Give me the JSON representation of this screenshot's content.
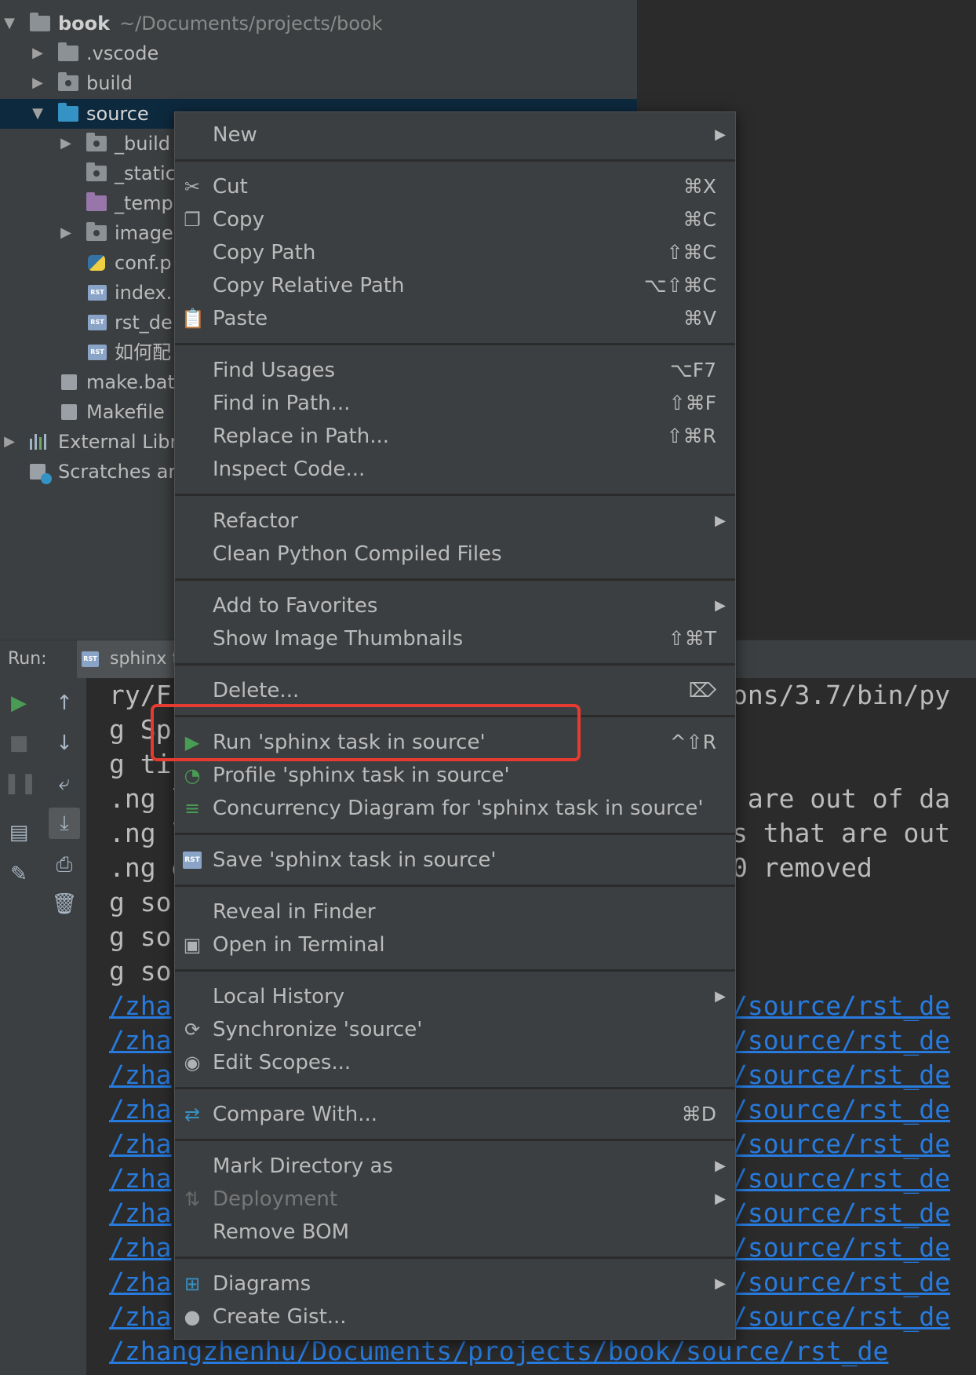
{
  "project_tree": {
    "root": {
      "name": "book",
      "path": "~/Documents/projects/book"
    },
    "items": [
      {
        "label": ".vscode"
      },
      {
        "label": "build"
      },
      {
        "label": "source"
      },
      {
        "label": "_build"
      },
      {
        "label": "_static"
      },
      {
        "label": "_temp"
      },
      {
        "label": "images"
      },
      {
        "label": "conf.p"
      },
      {
        "label": "index."
      },
      {
        "label": "rst_de"
      },
      {
        "label": "如何配"
      },
      {
        "label": "make.bat"
      },
      {
        "label": "Makefile"
      },
      {
        "label": "External Libr"
      },
      {
        "label": "Scratches ar"
      }
    ]
  },
  "run_panel": {
    "label": "Run:",
    "tab_label": "sphinx t",
    "console_lines": [
      "ry/F",
      "g Sp",
      "g ti",
      ".ng l",
      ".ng l",
      ".ng e",
      "g so",
      "g so",
      "g so",
      "/zha",
      "/zha",
      "/zha",
      "/zha",
      "/zha",
      "/zha",
      "/zha",
      "/zha",
      "/zha",
      "/zha",
      "/zhangzhenhu/Documents/projects/book/source/rst_de"
    ],
    "console_right": [
      "ons/3.7/bin/py",
      " are out of da",
      "s that are out",
      "0 removed",
      "/source/rst_de"
    ]
  },
  "context_menu": {
    "items": [
      {
        "label": "New",
        "shortcut": "",
        "icon": "none"
      },
      {
        "label": "Cut",
        "shortcut": "⌘X",
        "icon": "scissors-icon"
      },
      {
        "label": "Copy",
        "shortcut": "⌘C",
        "icon": "copy-icon"
      },
      {
        "label": "Copy Path",
        "shortcut": "⇧⌘C",
        "icon": "none"
      },
      {
        "label": "Copy Relative Path",
        "shortcut": "⌥⇧⌘C",
        "icon": "none"
      },
      {
        "label": "Paste",
        "shortcut": "⌘V",
        "icon": "paste-icon"
      },
      {
        "label": "Find Usages",
        "shortcut": "⌥F7",
        "icon": "none"
      },
      {
        "label": "Find in Path...",
        "shortcut": "⇧⌘F",
        "icon": "none"
      },
      {
        "label": "Replace in Path...",
        "shortcut": "⇧⌘R",
        "icon": "none"
      },
      {
        "label": "Inspect Code...",
        "shortcut": "",
        "icon": "none"
      },
      {
        "label": "Refactor",
        "shortcut": "",
        "icon": "none"
      },
      {
        "label": "Clean Python Compiled Files",
        "shortcut": "",
        "icon": "none"
      },
      {
        "label": "Add to Favorites",
        "shortcut": "",
        "icon": "none"
      },
      {
        "label": "Show Image Thumbnails",
        "shortcut": "⇧⌘T",
        "icon": "none"
      },
      {
        "label": "Delete...",
        "shortcut": "⌦",
        "icon": "none"
      },
      {
        "label": "Run 'sphinx task in source'",
        "shortcut": "^⇧R",
        "icon": "run-icon"
      },
      {
        "label": "Profile 'sphinx task in source'",
        "shortcut": "",
        "icon": "profile-icon"
      },
      {
        "label": "Concurrency Diagram for 'sphinx task in source'",
        "shortcut": "",
        "icon": "concurrency-icon"
      },
      {
        "label": "Save 'sphinx task in source'",
        "shortcut": "",
        "icon": "rst-icon"
      },
      {
        "label": "Reveal in Finder",
        "shortcut": "",
        "icon": "none"
      },
      {
        "label": "Open in Terminal",
        "shortcut": "",
        "icon": "terminal-icon"
      },
      {
        "label": "Local History",
        "shortcut": "",
        "icon": "none"
      },
      {
        "label": "Synchronize 'source'",
        "shortcut": "",
        "icon": "sync-icon"
      },
      {
        "label": "Edit Scopes...",
        "shortcut": "",
        "icon": "scope-icon"
      },
      {
        "label": "Compare With...",
        "shortcut": "⌘D",
        "icon": "compare-icon"
      },
      {
        "label": "Mark Directory as",
        "shortcut": "",
        "icon": "none"
      },
      {
        "label": "Deployment",
        "shortcut": "",
        "icon": "deployment-icon"
      },
      {
        "label": "Remove BOM",
        "shortcut": "",
        "icon": "none"
      },
      {
        "label": "Diagrams",
        "shortcut": "",
        "icon": "diagram-icon"
      },
      {
        "label": "Create Gist...",
        "shortcut": "",
        "icon": "github-icon"
      }
    ]
  },
  "colors": {
    "highlight_box": "#e53b30",
    "selection": "#0d293e",
    "link": "#287bde"
  }
}
